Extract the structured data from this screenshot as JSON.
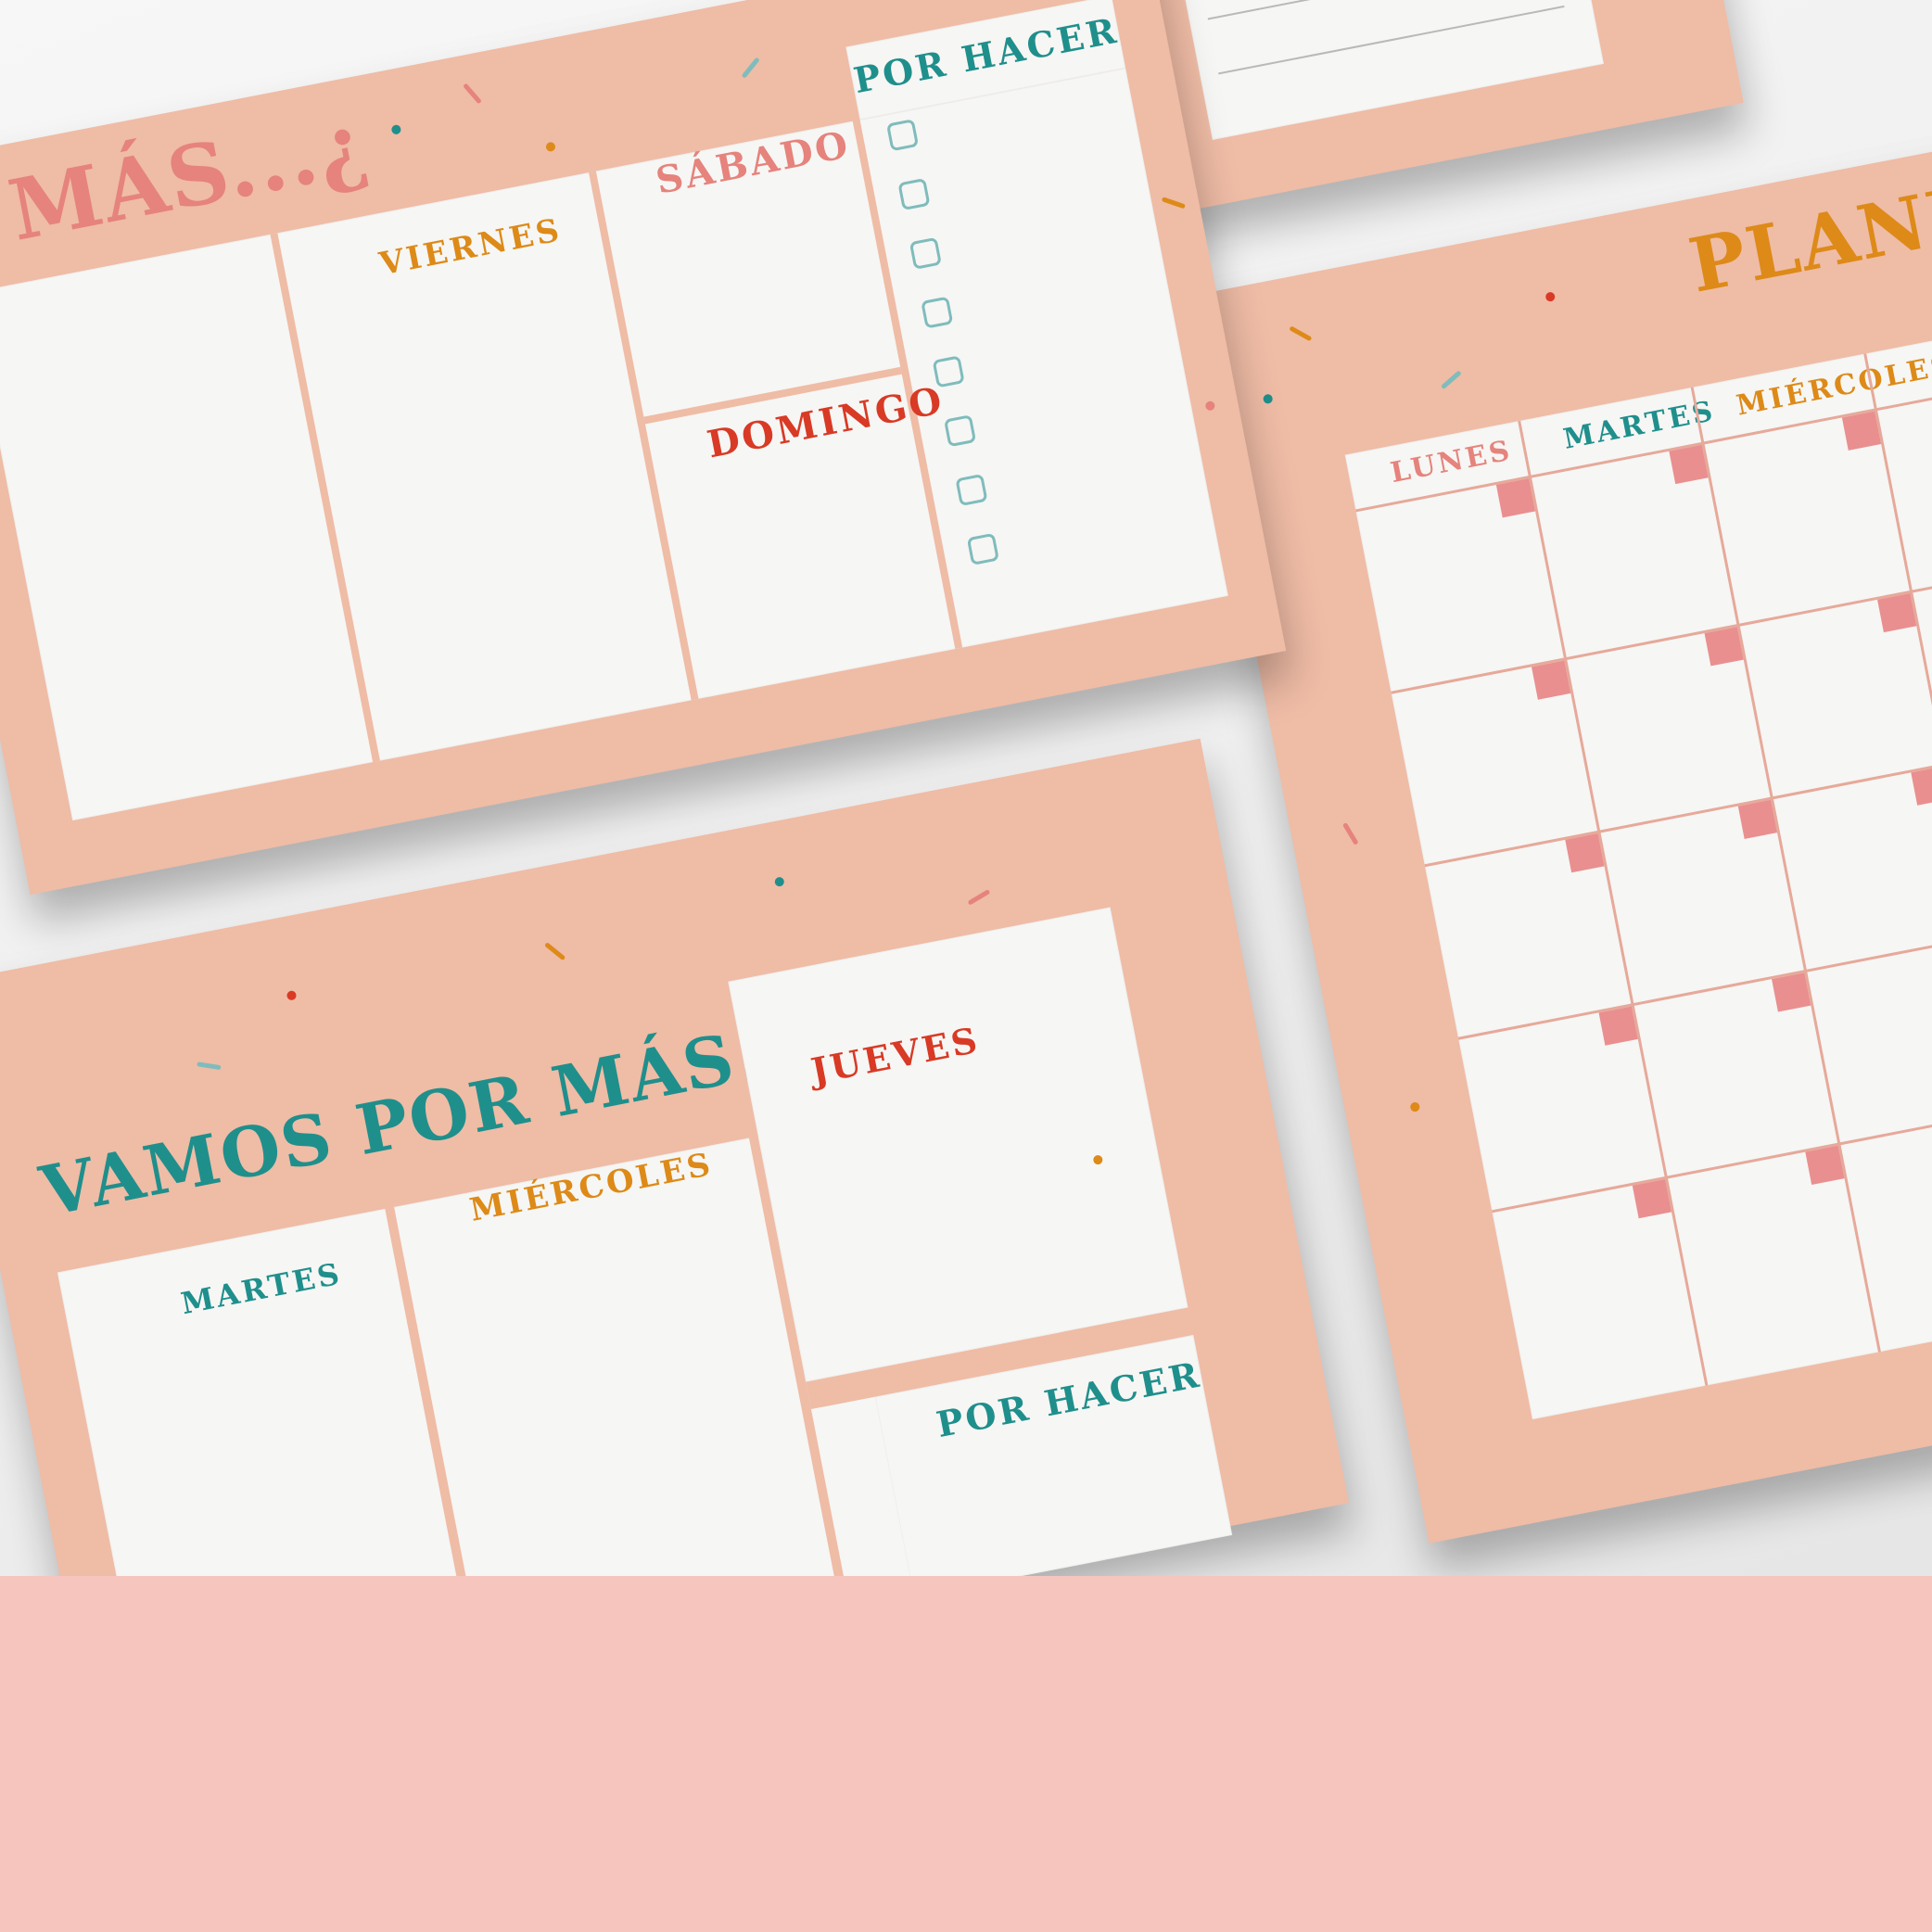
{
  "colors": {
    "sheet": "#efbca6",
    "panel": "#f6f6f4",
    "band": "#f5c5be",
    "teal": "#1f8f8c",
    "orange": "#dd8a18",
    "red": "#d83a25",
    "pink": "#e5837c",
    "calendar_square": "#e98f8f"
  },
  "top_planner": {
    "title": "MÁS...¿",
    "days": {
      "viernes": "VIERNES",
      "sabado": "SÁBADO",
      "domingo": "DOMINGO"
    },
    "todo_title": "POR HACER",
    "checkbox_count": 8
  },
  "bottom_planner": {
    "title": "VAMOS POR MÁS...",
    "days": {
      "martes": "MARTES",
      "miercoles": "MIÉRCOLES",
      "jueves": "JUEVES"
    },
    "todo_title": "POR HACER"
  },
  "monthly_planner": {
    "title": "PLANI",
    "days": [
      "LUNES",
      "MARTES",
      "MIÉRCOLES"
    ]
  }
}
